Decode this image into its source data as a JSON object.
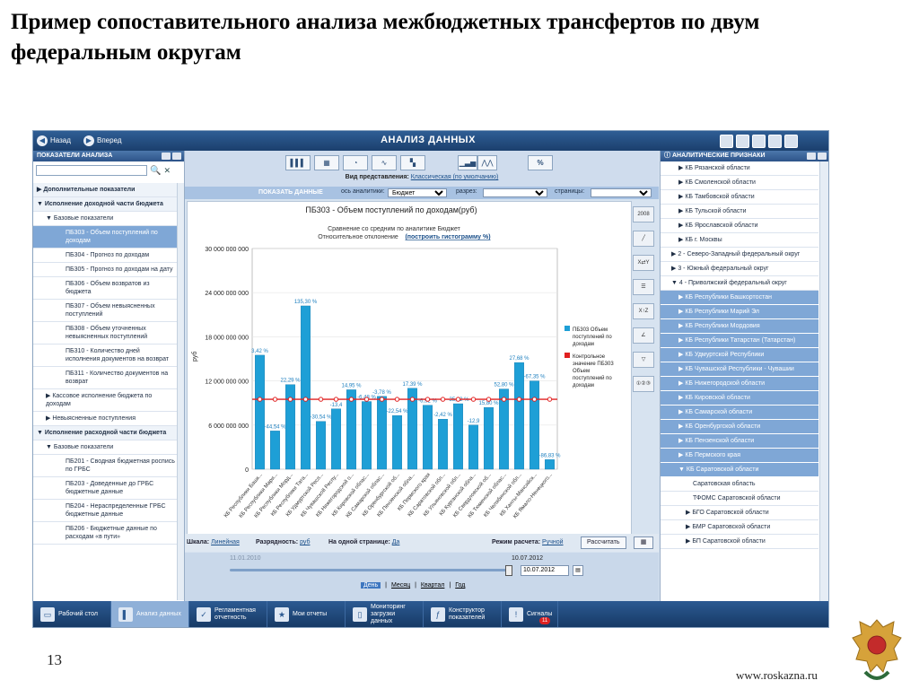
{
  "slide": {
    "title": "Пример сопоставительного анализа межбюджетных трансфертов по двум федеральным округам",
    "page_number": "13",
    "website": "www.roskazna.ru"
  },
  "app": {
    "back": "Назад",
    "forward": "Вперед",
    "title": "АНАЛИЗ ДАННЫХ"
  },
  "left_panel": {
    "header": "ПОКАЗАТЕЛИ АНАЛИЗА",
    "items": [
      {
        "label": "Дополнительные показатели",
        "level": 0,
        "arrow": "▶",
        "style": "bold"
      },
      {
        "label": "Исполнение доходной части бюджета",
        "level": 0,
        "arrow": "▼",
        "style": "bold"
      },
      {
        "label": "Базовые показатели",
        "level": 1,
        "arrow": "▼",
        "style": ""
      },
      {
        "label": "ПБ303 - Объем поступлений по доходам",
        "level": 2,
        "arrow": "",
        "style": "sel"
      },
      {
        "label": "ПБ304 - Прогноз по доходам",
        "level": 2,
        "arrow": "",
        "style": ""
      },
      {
        "label": "ПБ305 - Прогноз по доходам на дату",
        "level": 2,
        "arrow": "",
        "style": ""
      },
      {
        "label": "ПБ306 - Объем возвратов из бюджета",
        "level": 2,
        "arrow": "",
        "style": ""
      },
      {
        "label": "ПБ307 - Объем невыясненных поступлений",
        "level": 2,
        "arrow": "",
        "style": ""
      },
      {
        "label": "ПБ308 - Объем уточненных невыясненных поступлений",
        "level": 2,
        "arrow": "",
        "style": ""
      },
      {
        "label": "ПБ310 - Количество дней исполнения документов на возврат",
        "level": 2,
        "arrow": "",
        "style": ""
      },
      {
        "label": "ПБ311 - Количество документов на возврат",
        "level": 2,
        "arrow": "",
        "style": ""
      },
      {
        "label": "Кассовое исполнение бюджета по доходам",
        "level": 1,
        "arrow": "▶",
        "style": ""
      },
      {
        "label": "Невыясненные поступления",
        "level": 1,
        "arrow": "▶",
        "style": ""
      },
      {
        "label": "Исполнение расходной части бюджета",
        "level": 0,
        "arrow": "▼",
        "style": "bold"
      },
      {
        "label": "Базовые показатели",
        "level": 1,
        "arrow": "▼",
        "style": ""
      },
      {
        "label": "ПБ201 - Сводная бюджетная роспись по ГРБС",
        "level": 2,
        "arrow": "",
        "style": ""
      },
      {
        "label": "ПБ203 - Доведенные до ГРБС бюджетные данные",
        "level": 2,
        "arrow": "",
        "style": ""
      },
      {
        "label": "ПБ204 - Нераспределенные ГРБС бюджетные данные",
        "level": 2,
        "arrow": "",
        "style": ""
      },
      {
        "label": "ПБ206 - Бюджетные данные по расходам «в пути»",
        "level": 2,
        "arrow": "",
        "style": ""
      }
    ]
  },
  "toolbar": {
    "view_label": "Вид представления:",
    "view_value": "Классическая (по умолчанию)",
    "percent": "%",
    "show_data": "ПОКАЗАТЬ ДАННЫЕ",
    "axis_label": "ось аналитики:",
    "axis_value": "Бюджет",
    "slice_label": "разрез:",
    "slice_value": "",
    "pages_label": "страницы:",
    "pages_value": ""
  },
  "chart_data": {
    "type": "bar",
    "title": "ПБ303 - Объем поступлений по доходам(руб)",
    "subtitle": "Сравнение со средним по аналитике Бюджет",
    "subtitle2_prefix": "Относительное отклонение",
    "subtitle2_link": "(построить гистограмму %)",
    "ylabel": "руб",
    "ylim": [
      0,
      30000000000
    ],
    "yticks": [
      0,
      6000000000,
      12000000000,
      18000000000,
      24000000000,
      30000000000
    ],
    "ytick_labels": [
      "0",
      "6 000 000 000",
      "12 000 000 000",
      "18 000 000 000",
      "24 000 000 000",
      "30 000 000 000"
    ],
    "categories": [
      "КБ Республики Башк...",
      "КБ Республики Мари...",
      "КБ Республики Морд...",
      "КБ Республики Тата...",
      "КБ Удмуртской Респ...",
      "КБ Чувашской Респу...",
      "КБ Нижегородской о...",
      "КБ Кировской облас...",
      "КБ Самарской облас...",
      "КБ Оренбургской об...",
      "КБ Пензенской обла...",
      "КБ Пермского края",
      "КБ Саратовской обл...",
      "КБ Ульяновской обл...",
      "КБ Курганской обла...",
      "КБ Свердловской об...",
      "КБ Тюменской облас...",
      "КБ Челябинской обл...",
      "КБ Ханты-Мансийск...",
      "КБ Ямало-Ненецкого..."
    ],
    "series": [
      {
        "name": "ПБ303 Объем поступлений по доходам",
        "color": "#1e9fd6",
        "values": [
          15500000000,
          5200000000,
          11500000000,
          22200000000,
          6500000000,
          8200000000,
          10800000000,
          9200000000,
          9900000000,
          7300000000,
          11000000000,
          8700000000,
          6800000000,
          8900000000,
          6000000000,
          8400000000,
          10900000000,
          14500000000,
          12000000000,
          1300000000
        ]
      },
      {
        "name": "Контрольное значение ПБ303 Объем поступлений по доходам",
        "color": "#e02020",
        "value": 9500000000
      }
    ],
    "data_labels": [
      "3,42 %",
      "-44,54 %",
      "22,29 %",
      "135,30 %",
      "-30,54 %",
      "-13,4",
      "14,95 %",
      "-6,48 %",
      "-3,78 %",
      "-22,54 %",
      "17,39 %",
      "-6,92 %",
      "-2,42 %",
      "-35,92 %",
      "-12,9",
      "15,80 %",
      "52,80 %",
      "27,68 %",
      "-67,35 %",
      "-86,83 %"
    ],
    "legend": "right"
  },
  "bottom": {
    "scale_label": "Шкала:",
    "scale_value": "Линейная",
    "digit_label": "Разрядность:",
    "digit_value": "руб",
    "page_label": "На одной странице:",
    "page_value": "Да",
    "mode_label": "Режим расчета:",
    "mode_value": "Ручной",
    "calc_button": "Рассчитать"
  },
  "timeline": {
    "start_date": "11.01.2010",
    "end_date": "10.07.2012",
    "date_input": "10.07.2012",
    "periods": [
      "День",
      "Месяц",
      "Квартал",
      "Год"
    ],
    "selected_period": "День"
  },
  "right_panel": {
    "header": "АНАЛИТИЧЕСКИЕ ПРИЗНАКИ",
    "items": [
      {
        "label": "▶  КБ Рязанской области",
        "hl": false,
        "indent": 2
      },
      {
        "label": "▶  КБ Смоленской области",
        "hl": false,
        "indent": 2
      },
      {
        "label": "▶  КБ Тамбовской области",
        "hl": false,
        "indent": 2
      },
      {
        "label": "▶  КБ Тульской области",
        "hl": false,
        "indent": 2
      },
      {
        "label": "▶  КБ Ярославской области",
        "hl": false,
        "indent": 2
      },
      {
        "label": "▶  КБ г. Москвы",
        "hl": false,
        "indent": 2
      },
      {
        "label": "▶  2 - Северо-Западный федеральный округ",
        "hl": false,
        "indent": 1
      },
      {
        "label": "▶  3 - Южный федеральный округ",
        "hl": false,
        "indent": 1
      },
      {
        "label": "▼  4 - Приволжский федеральный округ",
        "hl": false,
        "indent": 1
      },
      {
        "label": "▶  КБ Республики Башкортостан",
        "hl": true,
        "indent": 2
      },
      {
        "label": "▶  КБ Республики Марий Эл",
        "hl": true,
        "indent": 2
      },
      {
        "label": "▶  КБ Республики Мордовия",
        "hl": true,
        "indent": 2
      },
      {
        "label": "▶  КБ Республики Татарстан (Татарстан)",
        "hl": true,
        "indent": 2
      },
      {
        "label": "▶  КБ Удмуртской Республики",
        "hl": true,
        "indent": 2
      },
      {
        "label": "▶  КБ Чувашской Республики - Чувашии",
        "hl": true,
        "indent": 2
      },
      {
        "label": "▶  КБ Нижегородской области",
        "hl": true,
        "indent": 2
      },
      {
        "label": "▶  КБ Кировской области",
        "hl": true,
        "indent": 2
      },
      {
        "label": "▶  КБ Самарской области",
        "hl": true,
        "indent": 2
      },
      {
        "label": "▶  КБ Оренбургской области",
        "hl": true,
        "indent": 2
      },
      {
        "label": "▶  КБ Пензенской области",
        "hl": true,
        "indent": 2
      },
      {
        "label": "▶  КБ Пермского края",
        "hl": true,
        "indent": 2
      },
      {
        "label": "▼  КБ Саратовской области",
        "hl": true,
        "indent": 2
      },
      {
        "label": "Саратовская область",
        "hl": false,
        "indent": 4
      },
      {
        "label": "ТФОМС Саратовской области",
        "hl": false,
        "indent": 4
      },
      {
        "label": "▶  БГО Саратовской области",
        "hl": false,
        "indent": 3
      },
      {
        "label": "▶  БМР Саратовской области",
        "hl": false,
        "indent": 3
      },
      {
        "label": "▶  БП Саратовской области",
        "hl": false,
        "indent": 3
      }
    ]
  },
  "taskbar": [
    {
      "label": "Рабочий стол",
      "icon": "desktop-icon",
      "active": false
    },
    {
      "label": "Анализ данных",
      "icon": "chart-icon",
      "active": true
    },
    {
      "label": "Регламентная отчетность",
      "icon": "report-icon",
      "active": false
    },
    {
      "label": "Мои отчеты",
      "icon": "star-icon",
      "active": false
    },
    {
      "label": "Мониторинг загрузки данных",
      "icon": "monitor-icon",
      "active": false
    },
    {
      "label": "Конструктор показателей",
      "icon": "function-icon",
      "active": false
    },
    {
      "label": "Сигналы",
      "icon": "signal-icon",
      "active": false,
      "badge": "11"
    }
  ]
}
